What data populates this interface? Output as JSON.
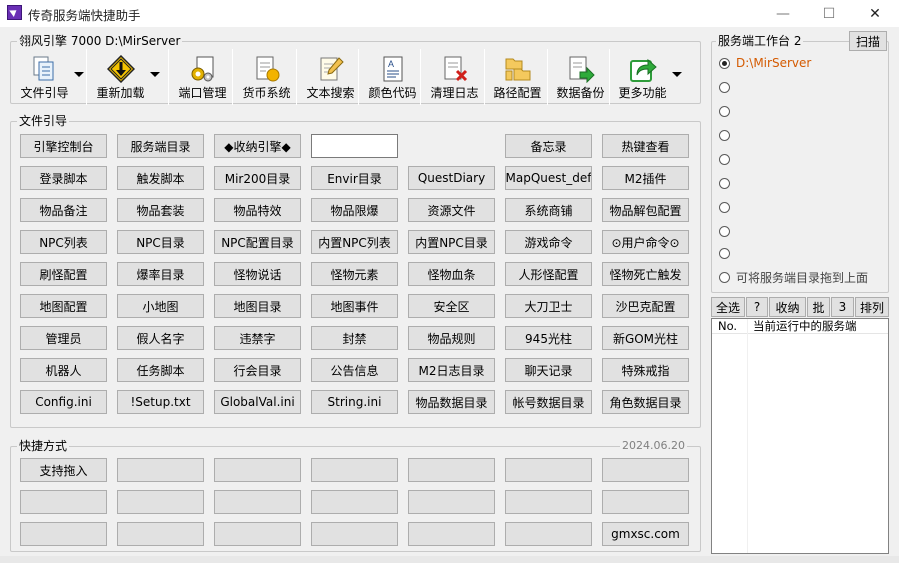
{
  "window": {
    "title": "传奇服务端快捷助手",
    "minimize": "—",
    "maximize": "☐",
    "close": "✕"
  },
  "engine_group": {
    "title": "翎风引擎 7000 D:\\MirServer",
    "toolbar": [
      {
        "label": "文件引导",
        "icon": "files-icon",
        "has_dropdown": true
      },
      {
        "label": "重新加载",
        "icon": "warning-sign-icon",
        "has_dropdown": true
      },
      {
        "label": "端口管理",
        "icon": "gears-icon",
        "has_dropdown": false
      },
      {
        "label": "货币系统",
        "icon": "coin-document-icon",
        "has_dropdown": false
      },
      {
        "label": "文本搜索",
        "icon": "edit-document-icon",
        "has_dropdown": false
      },
      {
        "label": "颜色代码",
        "icon": "text-document-icon",
        "has_dropdown": false
      },
      {
        "label": "清理日志",
        "icon": "delete-document-icon",
        "has_dropdown": false
      },
      {
        "label": "路径配置",
        "icon": "folders-icon",
        "has_dropdown": false
      },
      {
        "label": "数据备份",
        "icon": "export-document-icon",
        "has_dropdown": false
      },
      {
        "label": "更多功能",
        "icon": "share-arrow-icon",
        "has_dropdown": true
      }
    ]
  },
  "file_group": {
    "title": "文件引导",
    "input_value": "",
    "buttons": [
      [
        "引擎控制台",
        "服务端目录",
        "◆收纳引擎◆",
        null,
        "备忘录",
        "热键查看"
      ],
      [
        "登录脚本",
        "触发脚本",
        "Mir200目录",
        "Envir目录",
        "QuestDiary",
        "MapQuest_def",
        "M2插件"
      ],
      [
        "物品备注",
        "物品套装",
        "物品特效",
        "物品限爆",
        "资源文件",
        "系统商铺",
        "物品解包配置"
      ],
      [
        "NPC列表",
        "NPC目录",
        "NPC配置目录",
        "内置NPC列表",
        "内置NPC目录",
        "游戏命令",
        "⊙用户命令⊙"
      ],
      [
        "刷怪配置",
        "爆率目录",
        "怪物说话",
        "怪物元素",
        "怪物血条",
        "人形怪配置",
        "怪物死亡触发"
      ],
      [
        "地图配置",
        "小地图",
        "地图目录",
        "地图事件",
        "安全区",
        "大刀卫士",
        "沙巴克配置"
      ],
      [
        "管理员",
        "假人名字",
        "违禁字",
        "封禁",
        "物品规则",
        "945光柱",
        "新GOM光柱"
      ],
      [
        "机器人",
        "任务脚本",
        "行会目录",
        "公告信息",
        "M2日志目录",
        "聊天记录",
        "特殊戒指"
      ],
      [
        "Config.ini",
        "!Setup.txt",
        "GlobalVal.ini",
        "String.ini",
        "物品数据目录",
        "帐号数据目录",
        "角色数据目录"
      ]
    ]
  },
  "shortcut_group": {
    "title": "快捷方式",
    "date": "2024.06.20",
    "buttons": [
      [
        "支持拖入",
        "",
        "",
        "",
        "",
        "",
        ""
      ],
      [
        "",
        "",
        "",
        "",
        "",
        "",
        ""
      ],
      [
        "",
        "",
        "",
        "",
        "",
        "",
        "gmxsc.com"
      ]
    ]
  },
  "workbench": {
    "title": "服务端工作台 2",
    "scan_button": "扫描",
    "accent_color": "#d45a00",
    "radios": [
      {
        "label": "D:\\MirServer",
        "selected": true,
        "highlight": true
      },
      {
        "label": "",
        "selected": false
      },
      {
        "label": "",
        "selected": false
      },
      {
        "label": "",
        "selected": false
      },
      {
        "label": "",
        "selected": false
      },
      {
        "label": "",
        "selected": false
      },
      {
        "label": "",
        "selected": false
      },
      {
        "label": "",
        "selected": false
      },
      {
        "label": "",
        "selected": false
      },
      {
        "label": "可将服务端目录拖到上面",
        "selected": false,
        "muted": true
      }
    ],
    "actions": [
      "全选",
      "?",
      "收纳",
      "批",
      "3",
      "排列"
    ],
    "list_headers": [
      "No.",
      "当前运行中的服务端"
    ]
  }
}
